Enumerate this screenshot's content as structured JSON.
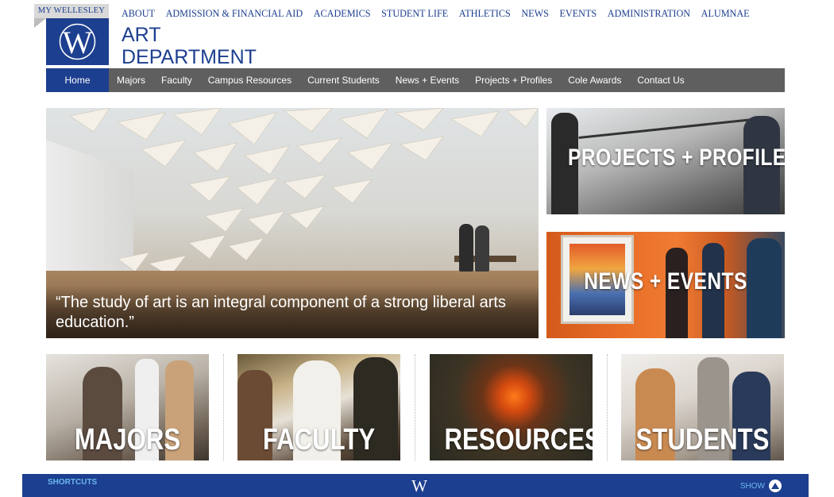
{
  "header": {
    "my_wellesley": "MY WELLESLEY",
    "logo_letter": "W",
    "title_line1": "ART",
    "title_line2": "DEPARTMENT",
    "brand_color": "#1d3f8f",
    "top_links": [
      "ABOUT",
      "ADMISSION & FINANCIAL AID",
      "ACADEMICS",
      "STUDENT LIFE",
      "ATHLETICS",
      "NEWS",
      "EVENTS",
      "ADMINISTRATION",
      "ALUMNAE"
    ]
  },
  "main_nav": {
    "items": [
      "Home",
      "Majors",
      "Faculty",
      "Campus Resources",
      "Current Students",
      "News + Events",
      "Projects + Profiles",
      "Cole Awards",
      "Contact Us"
    ],
    "active": "Home",
    "bar_color": "#5f5f5f"
  },
  "hero": {
    "quote": "“The study of art is an integral component of a strong liberal arts education.”"
  },
  "side_tiles": {
    "projects": "PROJECTS + PROFILES",
    "news": "NEWS + EVENTS"
  },
  "bottom_tiles": {
    "majors": "MAJORS",
    "faculty": "FACULTY",
    "resources": "RESOURCES",
    "students": "STUDENTS"
  },
  "footer": {
    "shortcuts": "SHORTCUTS",
    "show": "SHOW",
    "show_icon": "chevron-up-icon",
    "link_color": "#6ab8ef"
  }
}
